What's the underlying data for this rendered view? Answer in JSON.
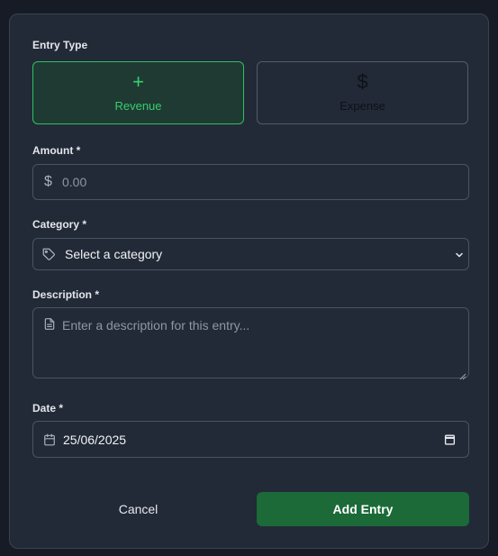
{
  "form": {
    "entry_type": {
      "label": "Entry Type",
      "options": [
        {
          "label": "Revenue",
          "glyph": "+",
          "icon": "plus-icon",
          "active": true
        },
        {
          "label": "Expense",
          "glyph": "$",
          "icon": "dollar-icon",
          "active": false
        }
      ]
    },
    "amount": {
      "label": "Amount *",
      "currency_symbol": "$",
      "placeholder": "0.00"
    },
    "category": {
      "label": "Category *",
      "selected": "Select a category",
      "icon": "tag-icon"
    },
    "description": {
      "label": "Description *",
      "placeholder": "Enter a description for this entry...",
      "icon": "document-icon"
    },
    "date": {
      "label": "Date *",
      "value": "25/06/2025",
      "icon": "calendar-icon"
    },
    "actions": {
      "cancel_label": "Cancel",
      "submit_label": "Add Entry"
    }
  },
  "colors": {
    "accent": "#36cf6c",
    "submit_bg": "#1b6a38",
    "card_bg": "#222a38",
    "page_bg": "#161b26"
  }
}
